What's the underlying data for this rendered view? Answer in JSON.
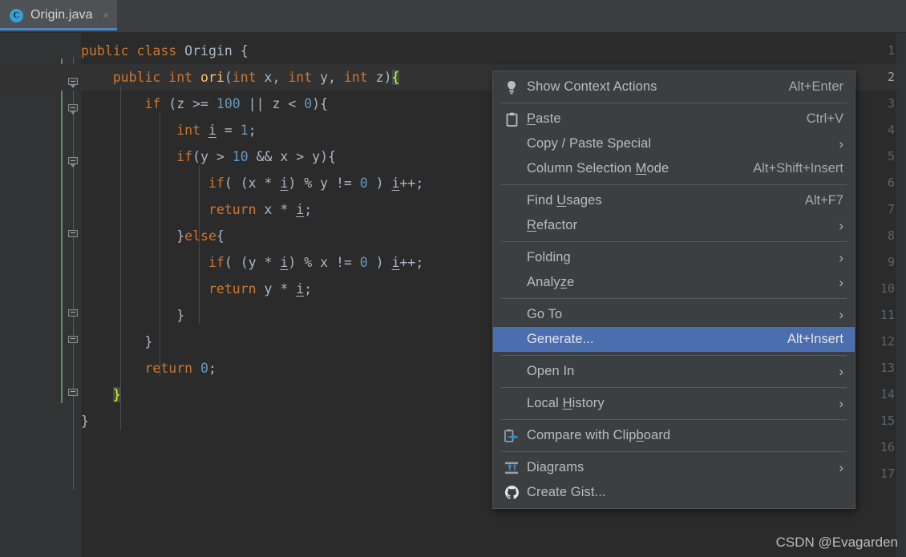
{
  "tab": {
    "icon": "java-class-icon",
    "label": "Origin.java",
    "close_label": "×"
  },
  "editor": {
    "line_numbers": [
      "1",
      "2",
      "3",
      "4",
      "5",
      "6",
      "7",
      "8",
      "9",
      "10",
      "11",
      "12",
      "13",
      "14",
      "15",
      "16",
      "17"
    ],
    "current_line": 2,
    "code_lines": [
      "public class Origin {",
      "    public int ori(int x, int y, int z){",
      "        if (z >= 100 || z < 0){",
      "            int i = 1;",
      "            if(y > 10 && x > y){",
      "                if( (x * i) % y != 0 ) i++;",
      "                return x * i;",
      "            }else{",
      "                if( (y * i) % x != 0 ) i++;",
      "                return y * i;",
      "            }",
      "        }",
      "        return 0;",
      "    }",
      "}",
      "",
      ""
    ],
    "colors": {
      "background": "#2b2b2b",
      "gutter": "#313335",
      "keyword": "#cc7832",
      "number": "#6897bb",
      "method": "#ffc66d",
      "text": "#a9b7c6",
      "brace_highlight_bg": "#3b514d",
      "brace_highlight_fg": "#ffef00",
      "change_marker": "#5f8f5f"
    }
  },
  "context_menu": {
    "selected_item": "Generate...",
    "accent": "#4b6eaf",
    "background": "#3c3f41",
    "items": [
      {
        "id": "show-context-actions",
        "label": "Show Context Actions",
        "shortcut": "Alt+Enter",
        "icon": "lightbulb-icon",
        "submenu": false,
        "mnemonic": "",
        "separator_after": true
      },
      {
        "id": "paste",
        "label": "Paste",
        "shortcut": "Ctrl+V",
        "icon": "clipboard-icon",
        "submenu": false,
        "mnemonic": "P",
        "separator_after": false
      },
      {
        "id": "copy-paste-special",
        "label": "Copy / Paste Special",
        "shortcut": "",
        "icon": "",
        "submenu": true,
        "mnemonic": "",
        "separator_after": false
      },
      {
        "id": "column-selection-mode",
        "label": "Column Selection Mode",
        "shortcut": "Alt+Shift+Insert",
        "icon": "",
        "submenu": false,
        "mnemonic": "M",
        "separator_after": true
      },
      {
        "id": "find-usages",
        "label": "Find Usages",
        "shortcut": "Alt+F7",
        "icon": "",
        "submenu": false,
        "mnemonic": "U",
        "separator_after": false
      },
      {
        "id": "refactor",
        "label": "Refactor",
        "shortcut": "",
        "icon": "",
        "submenu": true,
        "mnemonic": "R",
        "separator_after": true
      },
      {
        "id": "folding",
        "label": "Folding",
        "shortcut": "",
        "icon": "",
        "submenu": true,
        "mnemonic": "",
        "separator_after": false
      },
      {
        "id": "analyze",
        "label": "Analyze",
        "shortcut": "",
        "icon": "",
        "submenu": true,
        "mnemonic": "z",
        "separator_after": true
      },
      {
        "id": "go-to",
        "label": "Go To",
        "shortcut": "",
        "icon": "",
        "submenu": true,
        "mnemonic": "",
        "separator_after": false
      },
      {
        "id": "generate",
        "label": "Generate...",
        "shortcut": "Alt+Insert",
        "icon": "",
        "submenu": false,
        "mnemonic": "",
        "separator_after": true,
        "selected": true
      },
      {
        "id": "open-in",
        "label": "Open In",
        "shortcut": "",
        "icon": "",
        "submenu": true,
        "mnemonic": "",
        "separator_after": true
      },
      {
        "id": "local-history",
        "label": "Local History",
        "shortcut": "",
        "icon": "",
        "submenu": true,
        "mnemonic": "H",
        "separator_after": true
      },
      {
        "id": "compare-with-clipboard",
        "label": "Compare with Clipboard",
        "shortcut": "",
        "icon": "compare-clipboard-icon",
        "submenu": false,
        "mnemonic": "b",
        "separator_after": true
      },
      {
        "id": "diagrams",
        "label": "Diagrams",
        "shortcut": "",
        "icon": "diagram-icon",
        "submenu": true,
        "mnemonic": "",
        "separator_after": false
      },
      {
        "id": "create-gist",
        "label": "Create Gist...",
        "shortcut": "",
        "icon": "github-icon",
        "submenu": false,
        "mnemonic": "",
        "separator_after": false
      }
    ]
  },
  "watermark": "CSDN @Evagarden"
}
